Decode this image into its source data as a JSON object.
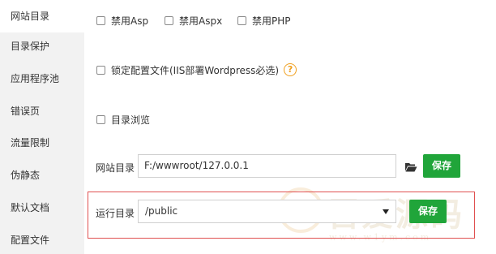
{
  "sidebar": {
    "items": [
      {
        "label": "网站目录"
      },
      {
        "label": "目录保护"
      },
      {
        "label": "应用程序池"
      },
      {
        "label": "错误页"
      },
      {
        "label": "流量限制"
      },
      {
        "label": "伪静态"
      },
      {
        "label": "默认文档"
      },
      {
        "label": "配置文件"
      }
    ]
  },
  "disable": {
    "asp": "禁用Asp",
    "aspx": "禁用Aspx",
    "php": "禁用PHP"
  },
  "lock_config": {
    "label": "锁定配置文件(IIS部署Wordpress必选)",
    "help_glyph": "?"
  },
  "dir_browse": {
    "label": "目录浏览"
  },
  "site_dir": {
    "label": "网站目录",
    "value": "F:/wwwroot/127.0.0.1",
    "save_label": "保存"
  },
  "run_dir": {
    "label": "运行目录",
    "selected": "/public",
    "save_label": "保存"
  },
  "watermark": {
    "text": "吾爱源码",
    "sub": "www.w1ym.com"
  },
  "colors": {
    "accent": "#20a53a",
    "highlight_border": "#e05050",
    "help": "#f0a020",
    "sidebar_bg": "#f2f2f2"
  }
}
